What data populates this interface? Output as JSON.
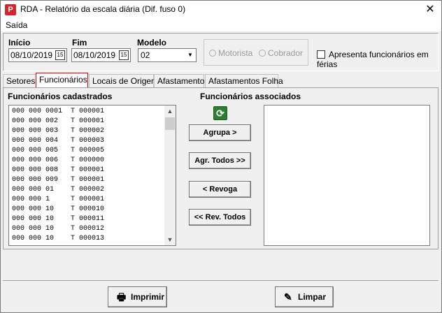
{
  "window": {
    "title": "RDA - Relatório da escala diária (Dif. fuso 0)",
    "app_icon": "P"
  },
  "menu": {
    "items": [
      "Saída"
    ]
  },
  "filters": {
    "inicio_label": "Início",
    "inicio_value": "08/10/2019",
    "fim_label": "Fim",
    "fim_value": "08/10/2019",
    "modelo_label": "Modelo",
    "modelo_value": "02",
    "radio_motorista": "Motorista",
    "radio_cobrador": "Cobrador",
    "ferias_label": "Apresenta funcionários em férias"
  },
  "tabs": [
    "Setores",
    "Funcionários",
    "Locais de Origem",
    "Afastamentos",
    "Afastamentos Folha"
  ],
  "active_tab": "Funcionários",
  "lists": {
    "cadastrados_header": "Funcionários cadastrados",
    "associados_header": "Funcionários associados",
    "cadastrados": [
      "000 000 0001  T 000001",
      "000 000 002   T 000001",
      "000 000 003   T 000002",
      "000 000 004   T 000003",
      "000 000 005   T 000005",
      "000 000 006   T 000000",
      "000 000 008   T 000001",
      "000 000 009   T 000001",
      "000 000 01    T 000002",
      "000 000 1     T 000001",
      "000 000 10    T 000010",
      "000 000 10    T 000011",
      "000 000 10    T 000012",
      "000 000 10    T 000013"
    ],
    "associados": []
  },
  "buttons": {
    "agrupa": "Agrupa >",
    "agr_todos": "Agr. Todos >>",
    "revoga": "< Revoga",
    "rev_todos": "<< Rev. Todos",
    "imprimir": "Imprimir",
    "limpar": "Limpar"
  },
  "icons": {
    "close": "close-icon",
    "calendar": "calendar-icon",
    "refresh": "refresh-icon",
    "print": "printer-icon",
    "clear": "eraser-icon"
  },
  "colors": {
    "app_icon": "#d9232d",
    "active_tab_border": "#dd0000",
    "refresh": "#2e7d32"
  }
}
